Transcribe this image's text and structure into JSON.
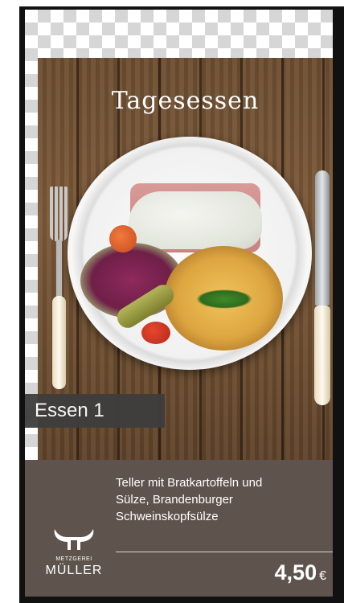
{
  "menu_card": {
    "title": "Tagesessen",
    "dish_label": "Essen 1",
    "description_lines": [
      "Teller mit Bratkartoffeln und",
      "Sülze, Brandenburger",
      "Schweinskopfsülze"
    ],
    "price": "4,50",
    "currency": "€",
    "brand_small": "METZGEREI",
    "brand_name": "MÜLLER"
  },
  "colors": {
    "panel": "#5e544d",
    "label_bg": "#3e3e3e",
    "text": "#ffffff"
  },
  "icons": [
    "bull-horns-logo-icon",
    "fork-icon",
    "knife-icon",
    "plate-image"
  ]
}
